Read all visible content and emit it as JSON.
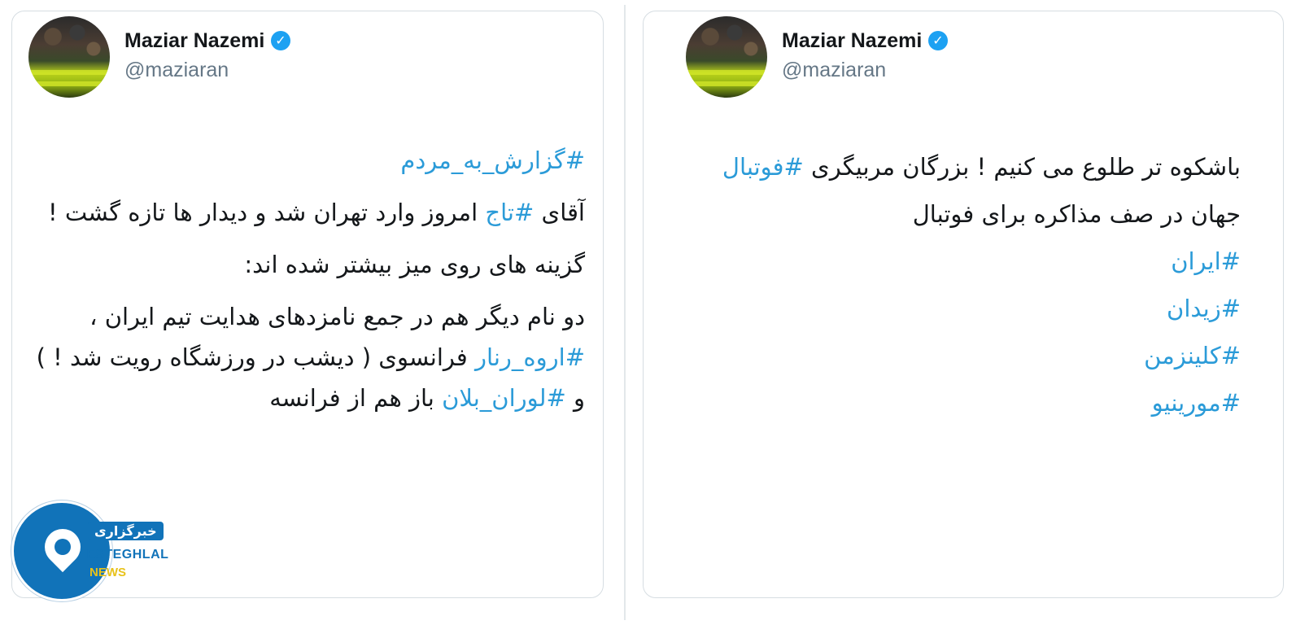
{
  "left_tweet": {
    "author_name": "Maziar Nazemi",
    "author_handle": "@maziaran",
    "paragraphs": [
      [
        {
          "t": "#گزارش_به_مردم",
          "tag": true
        }
      ],
      [
        {
          "t": "آقای ",
          "tag": false
        },
        {
          "t": "#تاج",
          "tag": true
        },
        {
          "t": " امروز وارد تهران شد و دیدار ها تازه گشت !",
          "tag": false
        }
      ],
      [
        {
          "t": "گزینه های روی میز بیشتر شده اند:",
          "tag": false
        }
      ],
      [
        {
          "t": "دو نام دیگر هم در جمع نامزدهای هدایت تیم ایران ، ",
          "tag": false
        },
        {
          "t": "#اروه_رنار",
          "tag": true
        },
        {
          "t": " فرانسوی ( دیشب در ورزشگاه رویت شد ! ) و ",
          "tag": false
        },
        {
          "t": "#لوران_بلان",
          "tag": true
        },
        {
          "t": " باز هم از فرانسه",
          "tag": false
        }
      ]
    ]
  },
  "right_tweet": {
    "author_name": "Maziar Nazemi",
    "author_handle": "@maziaran",
    "paragraphs": [
      [
        {
          "t": "باشکوه تر طلوع می کنیم ! بزرگان مربیگری ",
          "tag": false
        },
        {
          "t": "#فوتبال",
          "tag": true
        },
        {
          "t": " جهان در صف مذاکره برای فوتبال",
          "tag": false
        }
      ],
      [
        {
          "t": "#ایران",
          "tag": true
        }
      ],
      [
        {
          "t": "#زیدان",
          "tag": true
        }
      ],
      [
        {
          "t": "#کلینزمن",
          "tag": true
        }
      ],
      [
        {
          "t": "#مورینیو",
          "tag": true
        }
      ]
    ]
  },
  "verified_icon": "verified-badge-icon",
  "watermark": {
    "title_fa": "خبرگزاری",
    "title_en": "ESTEGHLAL",
    "subtitle_en": "NEWS"
  },
  "colors": {
    "hashtag": "#2b9bd8",
    "verified": "#1da1f2",
    "handle": "#657786",
    "text": "#14171a"
  }
}
